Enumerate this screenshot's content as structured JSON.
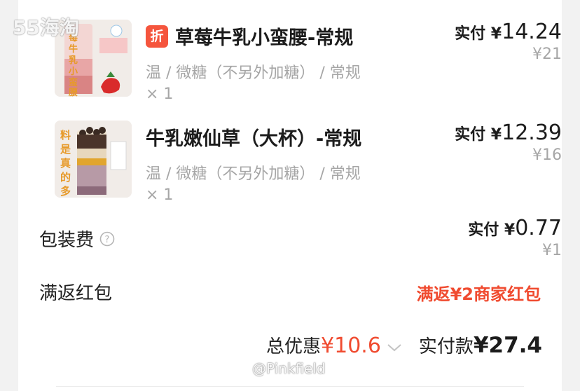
{
  "watermark": {
    "logo": "55海淘",
    "user": "@Pinkfield"
  },
  "items": [
    {
      "discount_tag": "折",
      "name": "草莓牛乳小蛮腰-常规",
      "spec": "温 / 微糖（不另外加糖） / 常规",
      "qty": "× 1",
      "paid_label": "实付 ¥",
      "paid_value": "14.24",
      "original_price": "¥21",
      "thumb_text": "莓牛乳小蛮腰"
    },
    {
      "name": "牛乳嫩仙草（大杯）-常规",
      "spec": "温 / 微糖（不另外加糖） / 常规",
      "qty": "× 1",
      "paid_label": "实付 ¥",
      "paid_value": "12.39",
      "original_price": "¥16",
      "thumb_text": "料是真的多"
    }
  ],
  "packing_fee": {
    "label": "包装费",
    "paid_label": "实付 ¥",
    "paid_value": "0.77",
    "original_price": "¥1"
  },
  "red_packet": {
    "label": "满返红包",
    "value": "满返¥2商家红包"
  },
  "summary": {
    "discount_label": "总优惠",
    "discount_value": "¥10.6",
    "total_label": "实付款",
    "total_value": "¥27.4"
  },
  "colors": {
    "accent_red": "#f04b30",
    "tag_red": "#f5553d",
    "muted_text": "#a6a6a6"
  }
}
